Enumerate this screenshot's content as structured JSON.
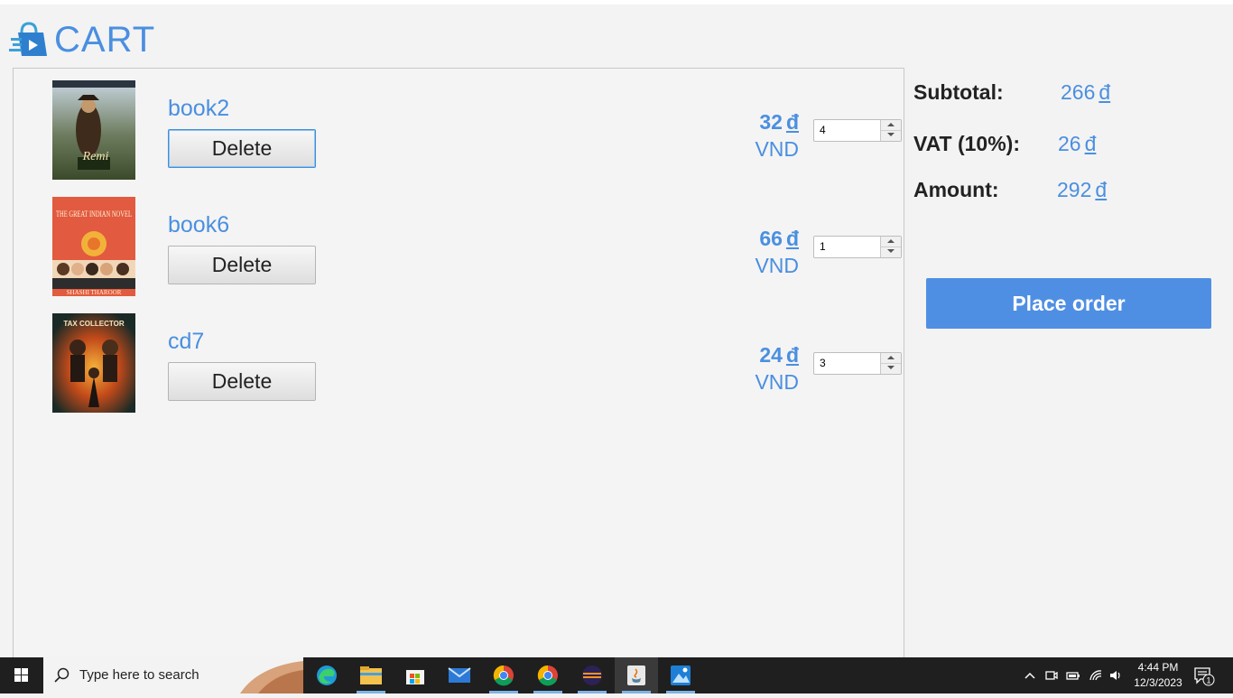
{
  "header": {
    "title": "CART",
    "logo_icon": "shopping-bag-icon"
  },
  "cart": {
    "items": [
      {
        "name": "book2",
        "delete_label": "Delete",
        "price": "32",
        "currency_symbol": "đ",
        "unit": "VND",
        "quantity": "4",
        "cover_title": "Remi"
      },
      {
        "name": "book6",
        "delete_label": "Delete",
        "price": "66",
        "currency_symbol": "đ",
        "unit": "VND",
        "quantity": "1",
        "cover_title": "THE GREAT INDIAN NOVEL",
        "cover_author": "SHASHI THAROOR"
      },
      {
        "name": "cd7",
        "delete_label": "Delete",
        "price": "24",
        "currency_symbol": "đ",
        "unit": "VND",
        "quantity": "3",
        "cover_title": "TAX COLLECTOR"
      }
    ]
  },
  "summary": {
    "subtotal_label": "Subtotal:",
    "subtotal_value": "266",
    "vat_label": "VAT (10%):",
    "vat_value": "26",
    "amount_label": "Amount:",
    "amount_value": "292",
    "currency_symbol": "đ",
    "place_order_label": "Place order"
  },
  "taskbar": {
    "search_placeholder": "Type here to search",
    "apps": [
      "edge-icon",
      "file-explorer-icon",
      "microsoft-store-icon",
      "mail-icon",
      "chrome-icon",
      "chrome-icon",
      "eclipse-icon",
      "java-icon",
      "photos-icon"
    ],
    "time": "4:44 PM",
    "date": "12/3/2023",
    "notification_count": "1"
  },
  "colors": {
    "accent": "#4a8fe0",
    "button_primary": "#4f8fe3",
    "taskbar": "#1f1f1f",
    "background": "#f3f3f3"
  }
}
